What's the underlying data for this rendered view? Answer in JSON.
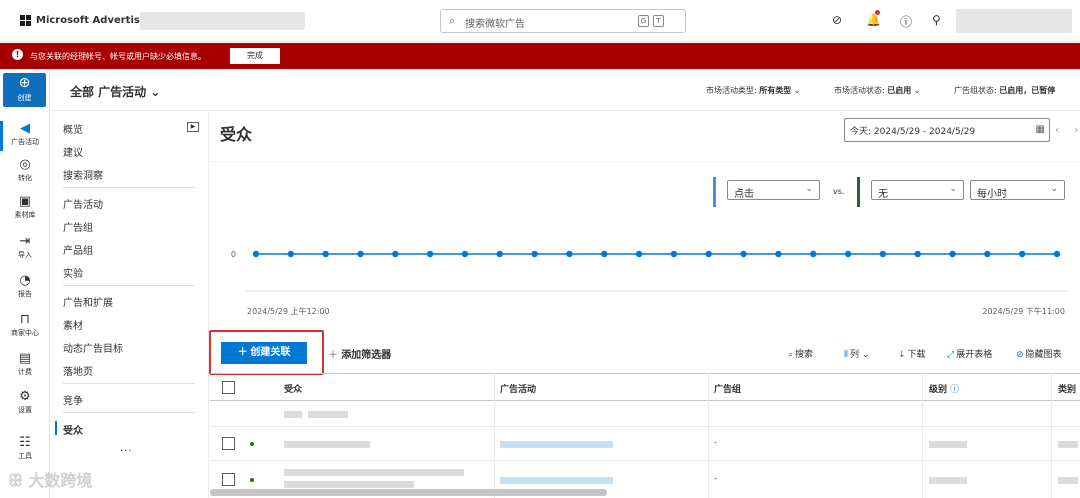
{
  "topbar": {
    "brand": "Microsoft Advertising",
    "search_placeholder": "搜索微软广告",
    "kb_keys": [
      "G",
      "T"
    ],
    "icons": [
      "copilot-icon",
      "lightbulb-icon",
      "bell-icon",
      "help-icon",
      "person-icon"
    ]
  },
  "banner": {
    "message": "与您关联的经理帐号、帐号或用户缺少必填信息。",
    "button": "完成",
    "color": "#a80000"
  },
  "leftnav": {
    "create_label": "创建",
    "items": [
      {
        "label": "广告活动",
        "icon": "megaphone-icon",
        "glyph": "📢",
        "active": true
      },
      {
        "label": "转化",
        "icon": "target-icon",
        "glyph": "◎"
      },
      {
        "label": "素材库",
        "icon": "library-icon",
        "glyph": "▣"
      },
      {
        "label": "导入",
        "icon": "import-icon",
        "glyph": "⇥"
      },
      {
        "label": "报告",
        "icon": "report-icon",
        "glyph": "◔"
      },
      {
        "label": "商家中心",
        "icon": "store-icon",
        "glyph": "⊓"
      },
      {
        "label": "计费",
        "icon": "billing-icon",
        "glyph": "▤"
      },
      {
        "label": "设置",
        "icon": "gear-icon",
        "glyph": "⚙"
      },
      {
        "label": "工具",
        "icon": "tools-icon",
        "glyph": "☷"
      }
    ]
  },
  "subheader": {
    "title": "全部 广告活动",
    "filters": [
      {
        "label": "市场活动类型:",
        "value": "所有类型"
      },
      {
        "label": "市场活动状态:",
        "value": "已启用"
      },
      {
        "label": "广告组状态:",
        "value": "已启用，已暂停"
      }
    ]
  },
  "sidepanel": {
    "group1": [
      "概览",
      "建议",
      "搜索洞察"
    ],
    "group2": [
      "广告活动",
      "广告组",
      "产品组",
      "实验"
    ],
    "group3": [
      "广告和扩展",
      "素材",
      "动态广告目标",
      "落地页"
    ],
    "group4": [
      "竞争",
      "受众"
    ],
    "active": "受众",
    "more": "..."
  },
  "main": {
    "title": "受众",
    "date_range": "今天: 2024/5/29 - 2024/5/29"
  },
  "chart": {
    "metric1": "点击",
    "vs": "vs.",
    "metric2": "无",
    "granularity": "每小时",
    "y_tick": "0",
    "x_start": "2024/5/29 上午12:00",
    "x_end": "2024/5/29 下午11:00",
    "line_color": "#0078d4",
    "metric1_color": "#4a90d9",
    "metric2_color": "#2e5e3e"
  },
  "chart_data": {
    "type": "line",
    "xlabel": "",
    "ylabel": "",
    "x_tick_labels": [
      "2024/5/29 上午12:00",
      "2024/5/29 下午11:00"
    ],
    "y_tick_labels": [
      "0"
    ],
    "series": [
      {
        "name": "点击",
        "values": [
          0,
          0,
          0,
          0,
          0,
          0,
          0,
          0,
          0,
          0,
          0,
          0,
          0,
          0,
          0,
          0,
          0,
          0,
          0,
          0,
          0,
          0,
          0,
          0
        ]
      }
    ]
  },
  "toolbar": {
    "create_button": "创建关联",
    "add_filter": "添加筛选器",
    "search": "搜索",
    "columns": "列",
    "download": "下载",
    "expand": "展开表格",
    "hide_chart": "隐藏图表"
  },
  "table": {
    "headers": [
      "受众",
      "广告活动",
      "广告组",
      "级别",
      "类别"
    ],
    "dash": "-"
  }
}
